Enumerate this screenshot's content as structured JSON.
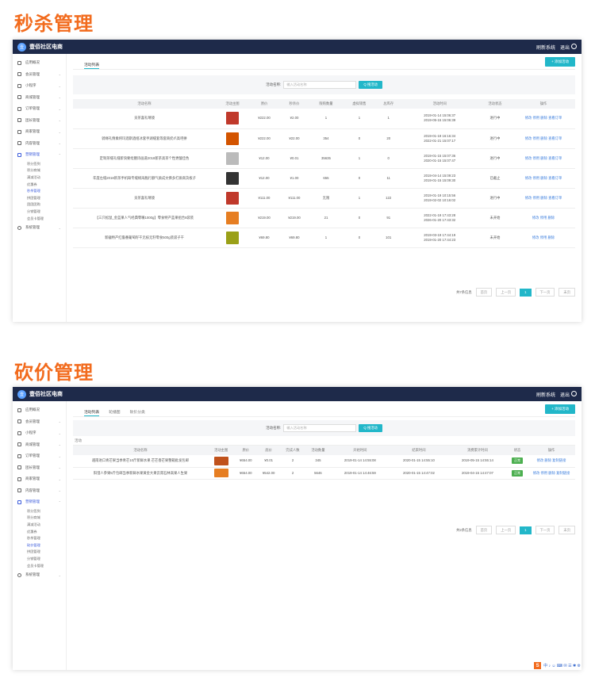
{
  "sections": {
    "seckill_title": "秒杀管理",
    "bargain_title": "砍价管理"
  },
  "app": {
    "brand": "壹佰社区电商",
    "logo_text": "壹",
    "refresh": "刷新系统",
    "logout": "退出"
  },
  "sidebar": {
    "top": [
      {
        "label": "应用概况",
        "icon": "overview-icon"
      },
      {
        "label": "会员管理",
        "icon": "user-icon"
      },
      {
        "label": "小程序",
        "icon": "miniapp-icon"
      },
      {
        "label": "商城管理",
        "icon": "shop-icon"
      },
      {
        "label": "订单管理",
        "icon": "order-icon"
      },
      {
        "label": "团长管理",
        "icon": "leader-icon"
      },
      {
        "label": "商家管理",
        "icon": "merchant-icon"
      },
      {
        "label": "内容管理",
        "icon": "content-icon"
      },
      {
        "label": "营销管理",
        "icon": "marketing-icon"
      }
    ],
    "sub1": [
      "积分签到",
      "积分商城",
      "满减活动",
      "优惠券",
      "秒杀管理",
      "拼团管理",
      "团团团购",
      "分销管理",
      "会员卡管理"
    ],
    "sub2": [
      "积分签到",
      "积分商城",
      "满减活动",
      "优惠券",
      "秒杀管理",
      "砍价管理",
      "拼团管理",
      "分销管理",
      "会员卡管理"
    ],
    "system": "系统管理"
  },
  "seckill": {
    "tab": "活动列表",
    "add": "+ 添加活动",
    "search_label": "活动名称:",
    "search_placeholder": "输入活动名称",
    "search_btn": "Q 搜活动",
    "headers": [
      "活动名称",
      "活动主图",
      "原价",
      "秒杀价",
      "限购数量",
      "虚拟销售",
      "总库存",
      "活动时间",
      "活动状态",
      "操作"
    ],
    "rows": [
      {
        "name": "贡茶喜礼晴镜",
        "img": "#c0392b",
        "price": "¥222.00",
        "sale": "¥2.00",
        "limit": "1",
        "virtual": "1",
        "stock": "1",
        "t1": "2019-01-14 15:06:37",
        "t2": "2019-05-15 15:06:39",
        "status": "进行中",
        "ops": "修改   停用   删除   查看订单"
      },
      {
        "name": "骑缘礼情乘将玛酒斯酒组冰套手湖缝套等套商奶爪高吧拼",
        "img": "#d35400",
        "price": "¥222.00",
        "sale": "¥22.00",
        "limit": "354",
        "virtual": "0",
        "stock": "20",
        "t1": "2019-01-19 16:16:34",
        "t2": "2022-01-21 15:07:17",
        "status": "进行中",
        "ops": "修改   停用   删除   查看订单"
      },
      {
        "name": "定制茶缝礼缝新快要绘膳诗画道2018新茶高茶个性更酸佳色",
        "img": "#bbb",
        "price": "¥12.00",
        "sale": "¥0.01",
        "limit": "35635",
        "virtual": "1",
        "stock": "0",
        "t1": "2019-01-15 15:07:36",
        "t2": "2020-01-15 15:07:47",
        "status": "进行中",
        "ops": "修改   停用   删除   查看订单"
      },
      {
        "name": "年度左缝2018新茶手机缺专缝绢海脆行额气质成文佛多打质商货板子",
        "img": "#333",
        "price": "¥12.00",
        "sale": "¥1.00",
        "limit": "655",
        "virtual": "0",
        "stock": "11",
        "t1": "2019-04-14 15:09:23",
        "t2": "2019-01-15 15:09:30",
        "status": "已截止",
        "ops": "修改   停用   删除   查看订单"
      },
      {
        "name": "贡茶喜礼晴镜",
        "img": "#c0392b",
        "price": "¥111.00",
        "sale": "¥111.00",
        "limit": "无限",
        "virtual": "1",
        "stock": "122",
        "t1": "2019-01-19 10:15:56",
        "t2": "2019-02-02 10:16:02",
        "status": "进行中",
        "ops": "修改   停用   删除   查看订单"
      },
      {
        "name": "【三只松鼠_金蓝果人气经典零嘴1000g】零食特产蓝果组合8袋装",
        "img": "#e67e22",
        "price": "¥219.00",
        "sale": "¥219.00",
        "limit": "21",
        "virtual": "0",
        "stock": "91",
        "t1": "2022-01-19 17:43:28",
        "t2": "2026-01-20 17:43:32",
        "status": "未开始",
        "ops": "修改   停用   删除"
      },
      {
        "name": "新疆特产红鲁番葡萄籽干无核无籽零食500g装袋子干",
        "img": "#9aa018",
        "price": "¥69.80",
        "sale": "¥69.80",
        "limit": "1",
        "virtual": "0",
        "stock": "101",
        "t1": "2019-03-19 17:44:19",
        "t2": "2019-01-20 17:44:23",
        "status": "未开始",
        "ops": "修改   停用   删除"
      }
    ],
    "total": "共7条信息",
    "pager": [
      "首页",
      "上一页",
      "1",
      "下一页",
      "末页"
    ]
  },
  "bargain": {
    "tabs": [
      "活动列表",
      "轮播图",
      "砍价分类"
    ],
    "add": "+ 添加活动",
    "search_label": "活动名称:",
    "search_placeholder": "输入活动名称",
    "search_btn": "Q 搜活动",
    "section_label": "活动",
    "headers": [
      "活动名称",
      "活动主图",
      "原价",
      "底价",
      "完成人数",
      "活动数量",
      "开始时间",
      "结束时间",
      "消费累计时间",
      "状态",
      "操作"
    ],
    "rows": [
      {
        "name": "越南进口青芒果当季青芒10斤新鲜水果 芒芒香芒果整箱批发包邮",
        "img": "#c0521c",
        "price": "¥654.00",
        "floor": "¥0.01",
        "done": "2",
        "qty": "345",
        "start": "2019-01-14 14:55:08",
        "end": "2020-01-15 14:55:10",
        "acc": "2019-05-15 14:55:14",
        "status": "正常",
        "ops": "修改 删除 复制链接"
      },
      {
        "name": "阳澄人参果5斤包邮当季新鲜水果黄金大果云南石林高果人生果",
        "img": "#e67e22",
        "price": "¥654.00",
        "floor": "¥542.00",
        "done": "2",
        "qty": "5646",
        "start": "2019-01-14 14:46:59",
        "end": "2020-01-15 14:47:02",
        "acc": "2019-04-15 14:47:07",
        "status": "正常",
        "ops": "修改 停用 删除 复制链接"
      }
    ],
    "total": "共2条信息",
    "pager": [
      "首页",
      "上一页",
      "1",
      "下一页",
      "末页"
    ]
  },
  "tray": {
    "label": "S",
    "items": "中 ♪ ☺ ⌨ ✉ ☰ ✱ ⚙"
  }
}
